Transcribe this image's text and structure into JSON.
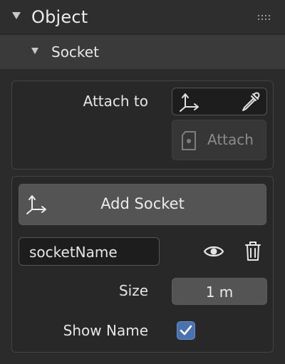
{
  "panel": {
    "title": "Object",
    "grip_icon": "drag-grip-icon"
  },
  "socket_panel": {
    "title": "Socket",
    "attach_to_label": "Attach to",
    "target_icon": "empty-axes-icon",
    "eyedropper_icon": "eyedropper-icon",
    "attach_button_label": "Attach",
    "attach_button_icon": "socket-attach-icon",
    "add_socket_label": "Add Socket",
    "add_socket_icon": "empty-axes-icon",
    "socket_name_value": "socketName",
    "visibility_icon": "eye-icon",
    "delete_icon": "trash-icon",
    "size_label": "Size",
    "size_value": "1 m",
    "show_name_label": "Show Name",
    "show_name_checked": true
  },
  "colors": {
    "accent": "#4a72b0",
    "panel_bg": "#2b2b2b"
  }
}
